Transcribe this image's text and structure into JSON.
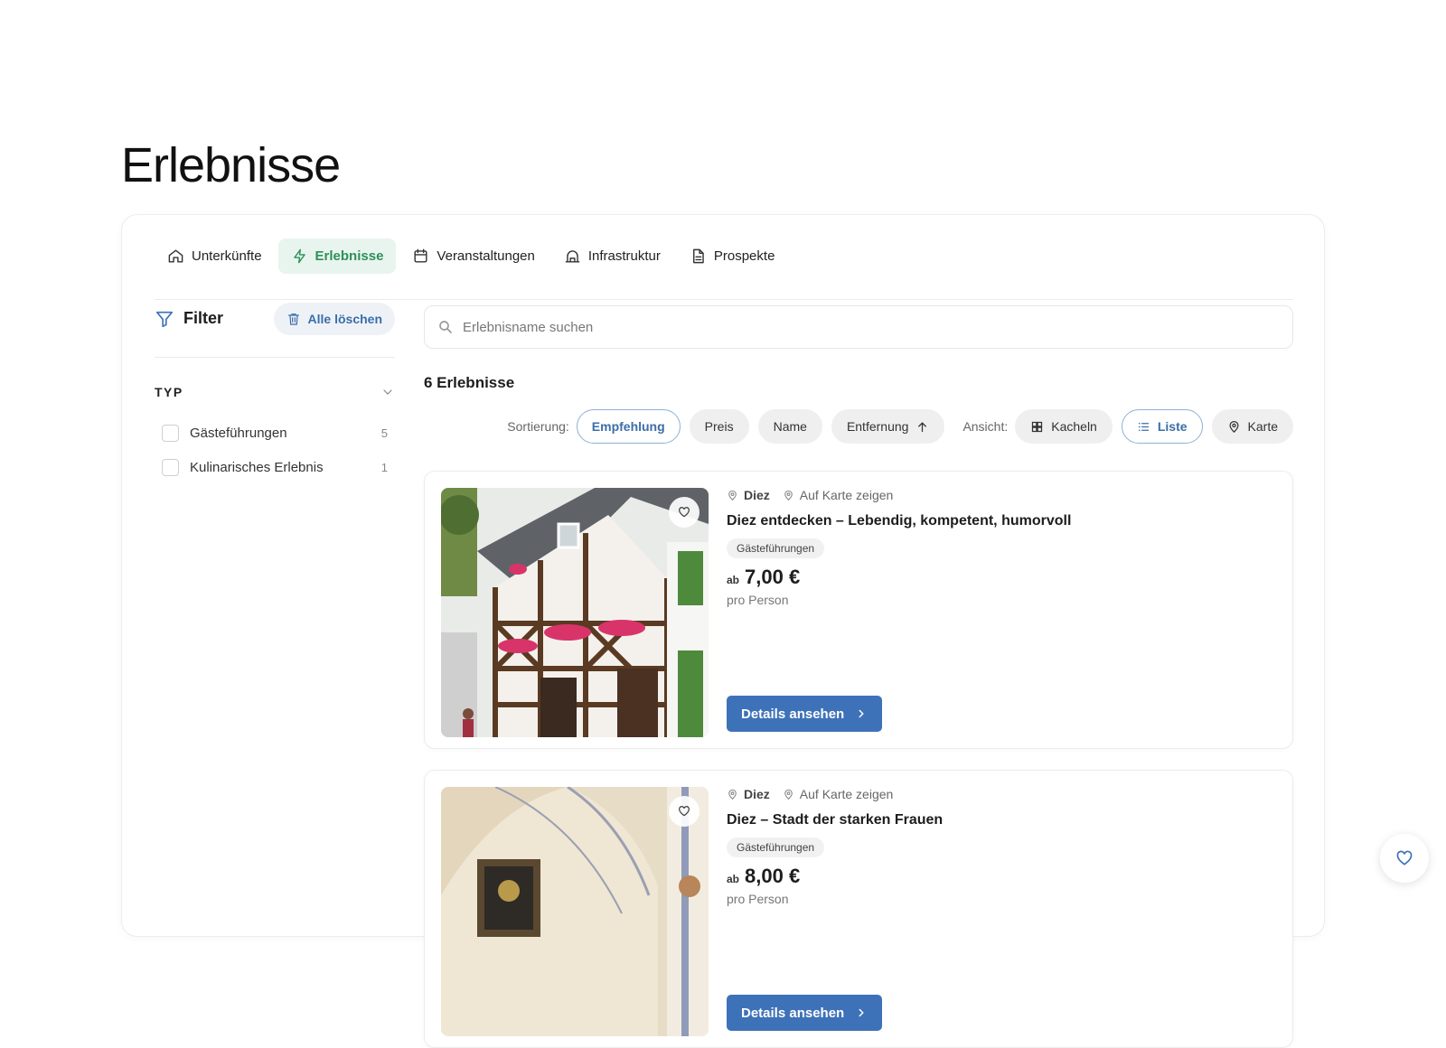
{
  "page": {
    "title": "Erlebnisse"
  },
  "tabs": [
    {
      "label": "Unterkünfte",
      "icon": "home-icon"
    },
    {
      "label": "Erlebnisse",
      "icon": "bolt-icon",
      "active": true
    },
    {
      "label": "Veranstaltungen",
      "icon": "calendar-icon"
    },
    {
      "label": "Infrastruktur",
      "icon": "infrastructure-icon"
    },
    {
      "label": "Prospekte",
      "icon": "document-icon"
    }
  ],
  "filter": {
    "title": "Filter",
    "clear_label": "Alle löschen",
    "group_title": "TYP",
    "options": [
      {
        "label": "Gästeführungen",
        "count": "5",
        "checked": false
      },
      {
        "label": "Kulinarisches Erlebnis",
        "count": "1",
        "checked": false
      }
    ]
  },
  "search": {
    "placeholder": "Erlebnisname suchen",
    "value": ""
  },
  "results": {
    "count_label": "6 Erlebnisse"
  },
  "sorting": {
    "label": "Sortierung:",
    "options": [
      {
        "label": "Empfehlung",
        "active": true
      },
      {
        "label": "Preis"
      },
      {
        "label": "Name"
      },
      {
        "label": "Entfernung",
        "icon": "arrow-up-icon"
      }
    ]
  },
  "view": {
    "label": "Ansicht:",
    "options": [
      {
        "label": "Kacheln",
        "icon": "grid-icon"
      },
      {
        "label": "Liste",
        "icon": "list-icon",
        "active": true
      },
      {
        "label": "Karte",
        "icon": "map-pin-icon"
      }
    ]
  },
  "cards": [
    {
      "city": "Diez",
      "map_link": "Auf Karte zeigen",
      "title": "Diez entdecken – Lebendig, kompetent, humorvoll",
      "category": "Gästeführungen",
      "price_prefix": "ab",
      "price": "7,00 €",
      "price_unit": "pro Person",
      "button": "Details ansehen"
    },
    {
      "city": "Diez",
      "map_link": "Auf Karte zeigen",
      "title": "Diez – Stadt der starken Frauen",
      "category": "Gästeführungen",
      "price_prefix": "ab",
      "price": "8,00 €",
      "price_unit": "pro Person",
      "button": "Details ansehen"
    }
  ],
  "colors": {
    "accent_green": "#2f8f5b",
    "accent_blue": "#3e72b8",
    "active_tab_bg": "#e8f5ee"
  }
}
